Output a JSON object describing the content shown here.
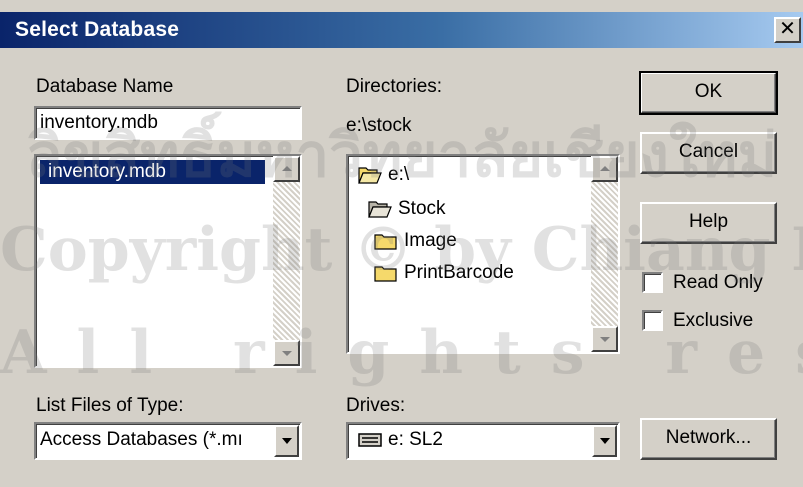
{
  "dialog": {
    "title": "Select Database",
    "close_glyph": "✕"
  },
  "database_name": {
    "label": "Database Name",
    "value": "inventory.mdb",
    "list_items": [
      "inventory.mdb"
    ],
    "selected_index": 0
  },
  "directories": {
    "label": "Directories:",
    "current_path": "e:\\stock",
    "tree": [
      "e:\\",
      "Stock",
      "Image",
      "PrintBarcode"
    ]
  },
  "buttons": {
    "ok": "OK",
    "cancel": "Cancel",
    "help": "Help",
    "network": "Network..."
  },
  "options": {
    "read_only": "Read Only",
    "exclusive": "Exclusive",
    "read_only_checked": false,
    "exclusive_checked": false
  },
  "file_type": {
    "label": "List Files of Type:",
    "value": "Access Databases (*.mı"
  },
  "drives": {
    "label": "Drives:",
    "value": "e: SL2"
  },
  "watermark": {
    "line1": "ลิขสิทธิ์มหาวิทยาลัยเชียงใหม่",
    "line2": "Copyright © by Chiang Mai University",
    "line3": "All rights reserved"
  },
  "colors": {
    "face": "#d4d0c8",
    "title_start": "#0a246a",
    "title_end": "#a6caf0",
    "selection": "#0a246a",
    "folder_yellow": "#f5d96b"
  }
}
